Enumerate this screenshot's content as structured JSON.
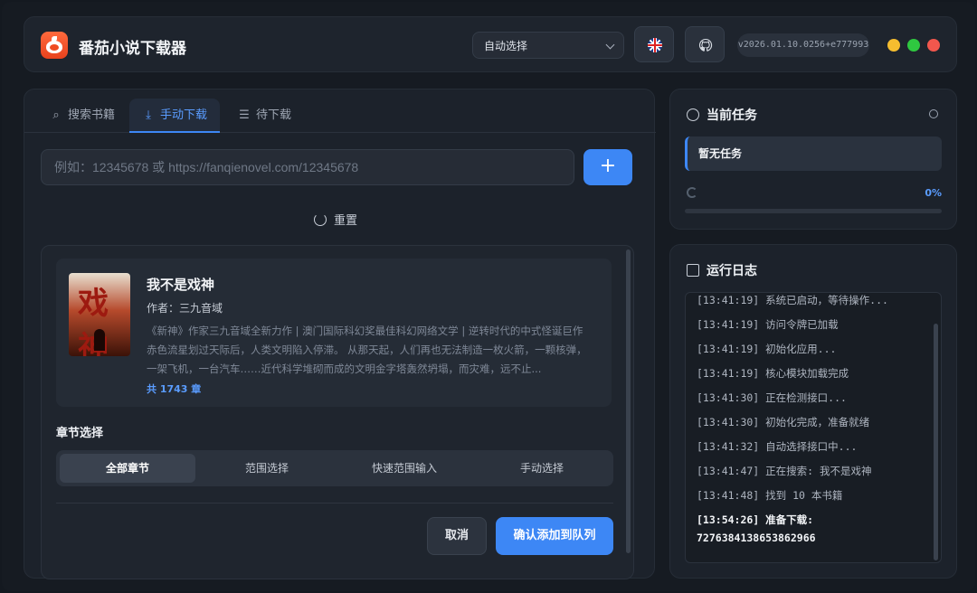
{
  "app": {
    "title": "番茄小说下载器",
    "api_select": "自动选择",
    "version": "v2026.01.10.0256+e777993"
  },
  "colors": {
    "accent": "#3d87f5",
    "traffic_yellow": "#f5bd2f",
    "traffic_green": "#2fc840",
    "traffic_red": "#f2574d"
  },
  "tabs": [
    {
      "label": "搜索书籍",
      "icon": "search-icon"
    },
    {
      "label": "手动下载",
      "icon": "download-icon"
    },
    {
      "label": "待下载",
      "icon": "list-icon"
    }
  ],
  "manual": {
    "input_placeholder": "例如：12345678 或 https://fanqienovel.com/12345678",
    "input_value": "",
    "add_label": "+",
    "reset_label": "重置"
  },
  "book": {
    "cover_text": "戏神",
    "title": "我不是戏神",
    "author": "作者：三九音域",
    "description": "《新神》作家三九音域全新力作 | 澳门国际科幻奖最佳科幻网络文学 | 逆转时代的中式怪诞巨作 赤色流星划过天际后，人类文明陷入停滞。 从那天起，人们再也无法制造一枚火箭，一颗核弹，一架飞机，一台汽车……近代科学堆砌而成的文明金字塔轰然坍塌，而灾难，远不止...",
    "chapters": "共 1743 章"
  },
  "chapter_select": {
    "label": "章节选择",
    "options": [
      "全部章节",
      "范围选择",
      "快速范围输入",
      "手动选择"
    ],
    "selected": "全部章节"
  },
  "actions": {
    "cancel": "取消",
    "confirm": "确认添加到队列"
  },
  "current_task": {
    "title": "当前任务",
    "status": "暂无任务",
    "progress_text": "0%",
    "progress": 0
  },
  "log": {
    "title": "运行日志",
    "lines": [
      "[13:41:19] 系统已启动，等待操作...",
      "[13:41:19] 访问令牌已加载",
      "[13:41:19] 初始化应用...",
      "[13:41:19] 核心模块加载完成",
      "[13:41:30] 正在检测接口...",
      "[13:41:30] 初始化完成，准备就绪",
      "[13:41:32] 自动选择接口中...",
      "[13:41:47] 正在搜索: 我不是戏神",
      "[13:41:48] 找到 10 本书籍",
      "[13:54:26] 准备下载:",
      "7276384138653862966"
    ]
  }
}
